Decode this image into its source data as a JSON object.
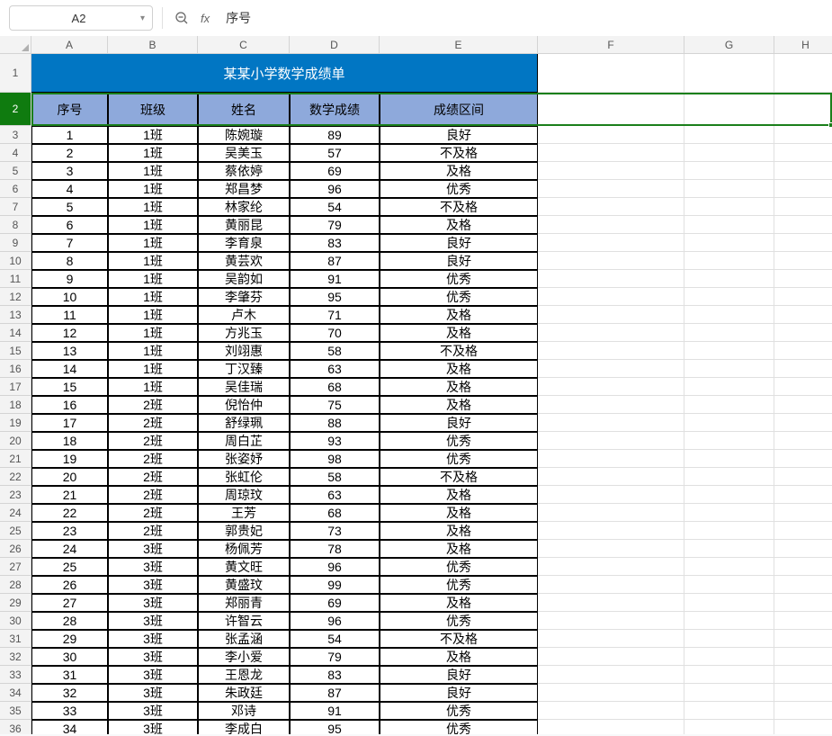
{
  "name_box": "A2",
  "formula_value": "序号",
  "columns": [
    "A",
    "B",
    "C",
    "D",
    "E",
    "F",
    "G",
    "H",
    ""
  ],
  "title": "某某小学数学成绩单",
  "headers": [
    "序号",
    "班级",
    "姓名",
    "数学成绩",
    "成绩区间"
  ],
  "rows": [
    {
      "n": "1",
      "cls": "1班",
      "name": "陈婉璇",
      "score": "89",
      "grade": "良好"
    },
    {
      "n": "2",
      "cls": "1班",
      "name": "吴美玉",
      "score": "57",
      "grade": "不及格"
    },
    {
      "n": "3",
      "cls": "1班",
      "name": "蔡依婷",
      "score": "69",
      "grade": "及格"
    },
    {
      "n": "4",
      "cls": "1班",
      "name": "郑昌梦",
      "score": "96",
      "grade": "优秀"
    },
    {
      "n": "5",
      "cls": "1班",
      "name": "林家纶",
      "score": "54",
      "grade": "不及格"
    },
    {
      "n": "6",
      "cls": "1班",
      "name": "黄丽昆",
      "score": "79",
      "grade": "及格"
    },
    {
      "n": "7",
      "cls": "1班",
      "name": "李育泉",
      "score": "83",
      "grade": "良好"
    },
    {
      "n": "8",
      "cls": "1班",
      "name": "黄芸欢",
      "score": "87",
      "grade": "良好"
    },
    {
      "n": "9",
      "cls": "1班",
      "name": "吴韵如",
      "score": "91",
      "grade": "优秀"
    },
    {
      "n": "10",
      "cls": "1班",
      "name": "李肇芬",
      "score": "95",
      "grade": "优秀"
    },
    {
      "n": "11",
      "cls": "1班",
      "name": "卢木",
      "score": "71",
      "grade": "及格"
    },
    {
      "n": "12",
      "cls": "1班",
      "name": "方兆玉",
      "score": "70",
      "grade": "及格"
    },
    {
      "n": "13",
      "cls": "1班",
      "name": "刘翊惠",
      "score": "58",
      "grade": "不及格"
    },
    {
      "n": "14",
      "cls": "1班",
      "name": "丁汉臻",
      "score": "63",
      "grade": "及格"
    },
    {
      "n": "15",
      "cls": "1班",
      "name": "吴佳瑞",
      "score": "68",
      "grade": "及格"
    },
    {
      "n": "16",
      "cls": "2班",
      "name": "倪怡仲",
      "score": "75",
      "grade": "及格"
    },
    {
      "n": "17",
      "cls": "2班",
      "name": "舒绿珮",
      "score": "88",
      "grade": "良好"
    },
    {
      "n": "18",
      "cls": "2班",
      "name": "周白芷",
      "score": "93",
      "grade": "优秀"
    },
    {
      "n": "19",
      "cls": "2班",
      "name": "张姿妤",
      "score": "98",
      "grade": "优秀"
    },
    {
      "n": "20",
      "cls": "2班",
      "name": "张虹伦",
      "score": "58",
      "grade": "不及格"
    },
    {
      "n": "21",
      "cls": "2班",
      "name": "周琼玟",
      "score": "63",
      "grade": "及格"
    },
    {
      "n": "22",
      "cls": "2班",
      "name": "王芳",
      "score": "68",
      "grade": "及格"
    },
    {
      "n": "23",
      "cls": "2班",
      "name": "郭贵妃",
      "score": "73",
      "grade": "及格"
    },
    {
      "n": "24",
      "cls": "3班",
      "name": "杨佩芳",
      "score": "78",
      "grade": "及格"
    },
    {
      "n": "25",
      "cls": "3班",
      "name": "黄文旺",
      "score": "96",
      "grade": "优秀"
    },
    {
      "n": "26",
      "cls": "3班",
      "name": "黄盛玟",
      "score": "99",
      "grade": "优秀"
    },
    {
      "n": "27",
      "cls": "3班",
      "name": "郑丽青",
      "score": "69",
      "grade": "及格"
    },
    {
      "n": "28",
      "cls": "3班",
      "name": "许智云",
      "score": "96",
      "grade": "优秀"
    },
    {
      "n": "29",
      "cls": "3班",
      "name": "张孟涵",
      "score": "54",
      "grade": "不及格"
    },
    {
      "n": "30",
      "cls": "3班",
      "name": "李小爱",
      "score": "79",
      "grade": "及格"
    },
    {
      "n": "31",
      "cls": "3班",
      "name": "王恩龙",
      "score": "83",
      "grade": "良好"
    },
    {
      "n": "32",
      "cls": "3班",
      "name": "朱政廷",
      "score": "87",
      "grade": "良好"
    },
    {
      "n": "33",
      "cls": "3班",
      "name": "邓诗",
      "score": "91",
      "grade": "优秀"
    },
    {
      "n": "34",
      "cls": "3班",
      "name": "李成白",
      "score": "95",
      "grade": "优秀"
    }
  ],
  "chart_data": {
    "type": "table",
    "title": "某某小学数学成绩单",
    "columns": [
      "序号",
      "班级",
      "姓名",
      "数学成绩",
      "成绩区间"
    ],
    "records": [
      [
        1,
        "1班",
        "陈婉璇",
        89,
        "良好"
      ],
      [
        2,
        "1班",
        "吴美玉",
        57,
        "不及格"
      ],
      [
        3,
        "1班",
        "蔡依婷",
        69,
        "及格"
      ],
      [
        4,
        "1班",
        "郑昌梦",
        96,
        "优秀"
      ],
      [
        5,
        "1班",
        "林家纶",
        54,
        "不及格"
      ],
      [
        6,
        "1班",
        "黄丽昆",
        79,
        "及格"
      ],
      [
        7,
        "1班",
        "李育泉",
        83,
        "良好"
      ],
      [
        8,
        "1班",
        "黄芸欢",
        87,
        "良好"
      ],
      [
        9,
        "1班",
        "吴韵如",
        91,
        "优秀"
      ],
      [
        10,
        "1班",
        "李肇芬",
        95,
        "优秀"
      ],
      [
        11,
        "1班",
        "卢木",
        71,
        "及格"
      ],
      [
        12,
        "1班",
        "方兆玉",
        70,
        "及格"
      ],
      [
        13,
        "1班",
        "刘翊惠",
        58,
        "不及格"
      ],
      [
        14,
        "1班",
        "丁汉臻",
        63,
        "及格"
      ],
      [
        15,
        "1班",
        "吴佳瑞",
        68,
        "及格"
      ],
      [
        16,
        "2班",
        "倪怡仲",
        75,
        "及格"
      ],
      [
        17,
        "2班",
        "舒绿珮",
        88,
        "良好"
      ],
      [
        18,
        "2班",
        "周白芷",
        93,
        "优秀"
      ],
      [
        19,
        "2班",
        "张姿妤",
        98,
        "优秀"
      ],
      [
        20,
        "2班",
        "张虹伦",
        58,
        "不及格"
      ],
      [
        21,
        "2班",
        "周琼玟",
        63,
        "及格"
      ],
      [
        22,
        "2班",
        "王芳",
        68,
        "及格"
      ],
      [
        23,
        "2班",
        "郭贵妃",
        73,
        "及格"
      ],
      [
        24,
        "3班",
        "杨佩芳",
        78,
        "及格"
      ],
      [
        25,
        "3班",
        "黄文旺",
        96,
        "优秀"
      ],
      [
        26,
        "3班",
        "黄盛玟",
        99,
        "优秀"
      ],
      [
        27,
        "3班",
        "郑丽青",
        69,
        "及格"
      ],
      [
        28,
        "3班",
        "许智云",
        96,
        "优秀"
      ],
      [
        29,
        "3班",
        "张孟涵",
        54,
        "不及格"
      ],
      [
        30,
        "3班",
        "李小爱",
        79,
        "及格"
      ],
      [
        31,
        "3班",
        "王恩龙",
        83,
        "良好"
      ],
      [
        32,
        "3班",
        "朱政廷",
        87,
        "良好"
      ],
      [
        33,
        "3班",
        "邓诗",
        91,
        "优秀"
      ],
      [
        34,
        "3班",
        "李成白",
        95,
        "优秀"
      ]
    ]
  }
}
